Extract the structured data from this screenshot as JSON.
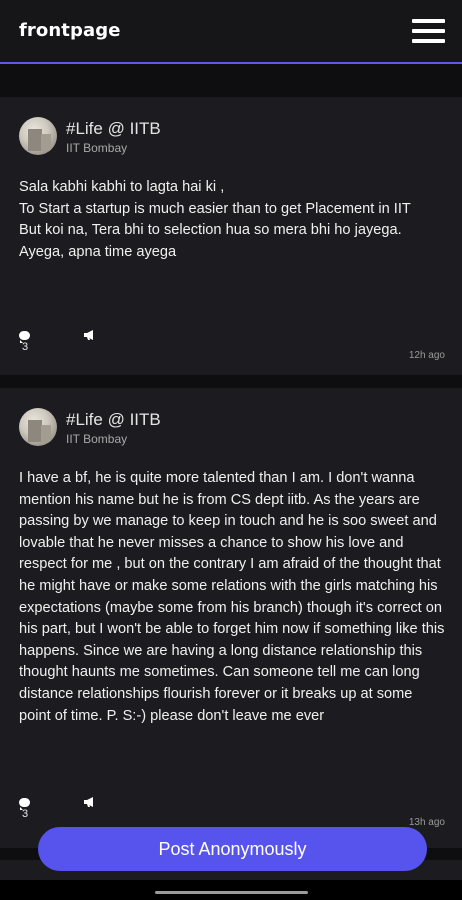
{
  "app": {
    "brand": "frontpage",
    "menu_icon": "hamburger-menu-icon",
    "accent_color": "#5b5bf0"
  },
  "posts": [
    {
      "hashtag": "#Life @ IITB",
      "institute": "IIT Bombay",
      "body": "Sala kabhi kabhi to lagta hai ki ,\nTo Start a startup is much easier than to get Placement in IIT\nBut koi na, Tera bhi to selection hua so mera bhi ho jayega.\nAyega, apna time ayega",
      "comment_count": "3",
      "time": "12h ago"
    },
    {
      "hashtag": "#Life @ IITB",
      "institute": "IIT Bombay",
      "body": "I have a bf, he is quite more talented than I am. I don't wanna mention his name but he is from CS dept iitb. As the years are passing by we manage to keep in touch and he is soo sweet and lovable that he never misses a chance to show his love and respect for me , but on the contrary I am afraid of the thought that he might have or make some relations with the girls matching his expectations (maybe some from his branch) though it's correct on his part, but I won't be able to forget him now if something like this happens. Since we are having a long distance relationship this thought haunts me sometimes. Can someone tell me can long distance relationships flourish forever or it breaks up at some point of time. P. S:-) please don't leave me ever",
      "comment_count": "3",
      "time": "13h ago"
    }
  ],
  "post_button": {
    "label": "Post Anonymously",
    "color": "#5654ec"
  }
}
